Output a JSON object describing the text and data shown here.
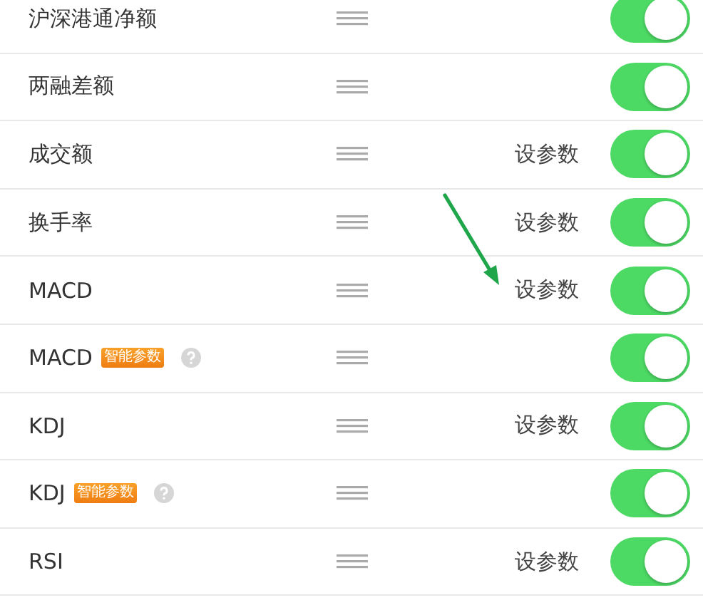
{
  "rows": [
    {
      "name": "沪深港通净额",
      "param_link": null,
      "badge": null,
      "help": false,
      "on": true
    },
    {
      "name": "两融差额",
      "param_link": null,
      "badge": null,
      "help": false,
      "on": true
    },
    {
      "name": "成交额",
      "param_link": "设参数",
      "badge": null,
      "help": false,
      "on": true
    },
    {
      "name": "换手率",
      "param_link": "设参数",
      "badge": null,
      "help": false,
      "on": true
    },
    {
      "name": "MACD",
      "param_link": "设参数",
      "badge": null,
      "help": false,
      "on": true
    },
    {
      "name": "MACD",
      "param_link": null,
      "badge": "智能参数",
      "help": true,
      "on": true
    },
    {
      "name": "KDJ",
      "param_link": "设参数",
      "badge": null,
      "help": false,
      "on": true
    },
    {
      "name": "KDJ",
      "param_link": null,
      "badge": "智能参数",
      "help": true,
      "on": true
    },
    {
      "name": "RSI",
      "param_link": "设参数",
      "badge": null,
      "help": false,
      "on": true
    }
  ]
}
